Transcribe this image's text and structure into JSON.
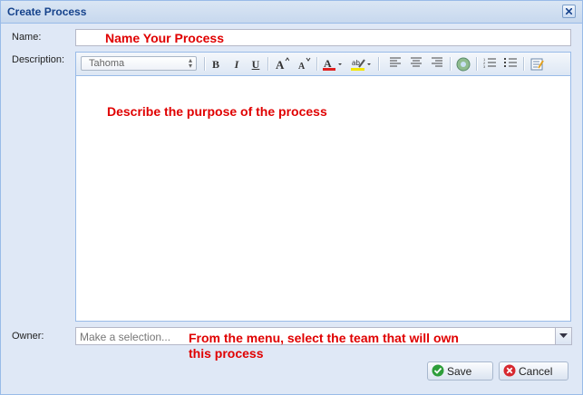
{
  "dialog": {
    "title": "Create Process"
  },
  "name": {
    "label": "Name:",
    "annotation": "Name Your Process"
  },
  "description": {
    "label": "Description:",
    "annotation": "Describe the purpose of the process",
    "font": "Tahoma",
    "buttons": [
      "B",
      "I",
      "U"
    ]
  },
  "owner": {
    "label": "Owner:",
    "placeholder": "Make a selection...",
    "annotation_line1": "From the menu, select the team that will own",
    "annotation_line2": "this process"
  },
  "actions": {
    "save": "Save",
    "cancel": "Cancel"
  },
  "colors": {
    "annotation": "#e00000",
    "title": "#15428b",
    "save_icon": "#2e9e3a",
    "cancel_icon": "#d7282f"
  }
}
